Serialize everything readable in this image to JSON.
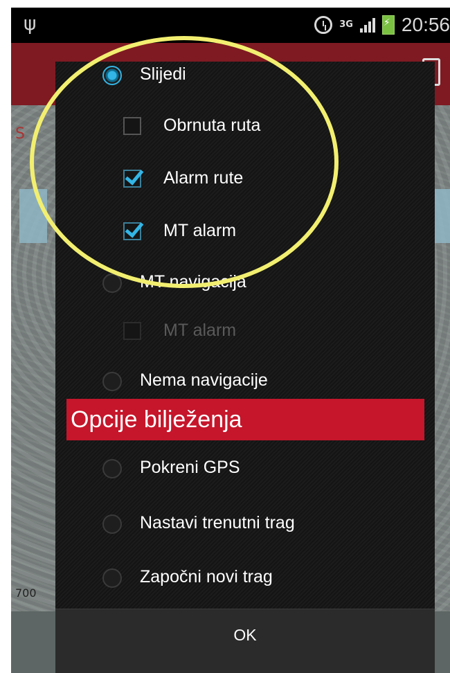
{
  "status_bar": {
    "time": "20:56",
    "network": "3G",
    "usb_icon": "usb-icon",
    "alarm_icon": "alarm-clock-icon",
    "signal_icon": "signal-icon",
    "battery_icon": "battery-charging-icon"
  },
  "background": {
    "fragment_left": "S",
    "scale_label": "700"
  },
  "navigation_options": {
    "follow": {
      "label": "Slijedi",
      "selected": true
    },
    "reverse_route": {
      "label": "Obrnuta ruta",
      "checked": false
    },
    "route_alarm": {
      "label": "Alarm rute",
      "checked": true
    },
    "mt_alarm": {
      "label": "MT alarm",
      "checked": true
    },
    "mt_navigation": {
      "label": "MT navigacija",
      "selected": false
    },
    "mt_alarm_disabled": {
      "label": "MT alarm",
      "checked": false,
      "enabled": false
    },
    "no_navigation": {
      "label": "Nema navigacije",
      "selected": false
    }
  },
  "recording_section": {
    "title": "Opcije bilježenja",
    "options": [
      {
        "label": "Pokreni GPS",
        "selected": false
      },
      {
        "label": "Nastavi trenutni trag",
        "selected": false
      },
      {
        "label": "Započni novi trag",
        "selected": false
      }
    ]
  },
  "footer": {
    "ok_label": "OK"
  },
  "colors": {
    "accent_blue": "#33b5e5",
    "section_red": "#c5162b",
    "highlight_yellow": "#f2ef70"
  }
}
